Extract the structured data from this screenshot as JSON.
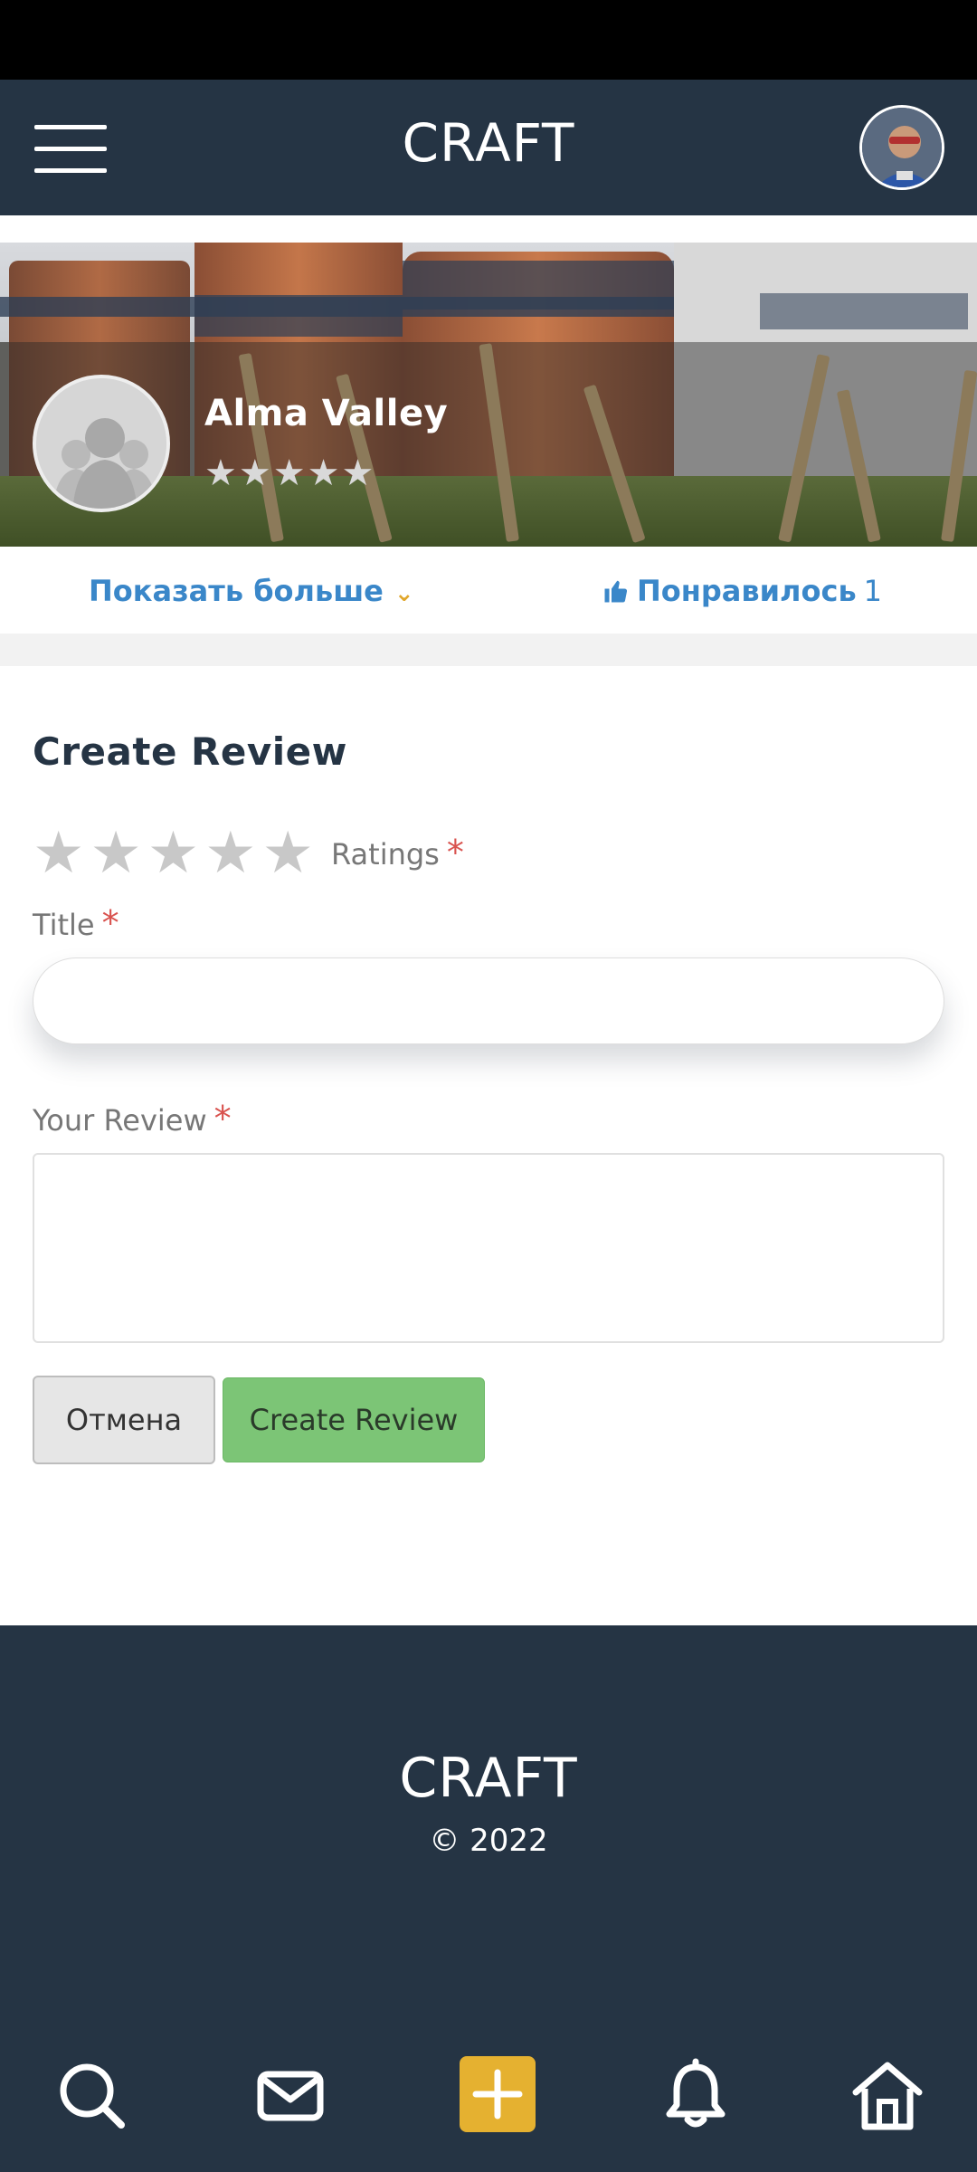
{
  "header": {
    "brand": "CRAFT",
    "menu_icon": "hamburger-menu-icon",
    "avatar_icon": "user-avatar"
  },
  "page": {
    "name": "Alma Valley",
    "rating_stars": "★★★★★",
    "avatar_icon": "group-placeholder-icon"
  },
  "actions": {
    "show_more_label": "Показать больше",
    "show_more_icon": "chevron-down-icon",
    "liked_label": "Понравилось",
    "liked_count": "1",
    "liked_icon": "thumbs-up-icon"
  },
  "form": {
    "heading": "Create Review",
    "ratings_label": "Ratings",
    "required_mark": "*",
    "title_label": "Title",
    "title_value": "",
    "review_label": "Your Review",
    "review_value": "",
    "cancel_label": "Отмена",
    "submit_label": "Create Review"
  },
  "footer": {
    "brand": "CRAFT",
    "copyright": "© 2022"
  },
  "bottom_nav": {
    "items": [
      "search-icon",
      "mail-icon",
      "plus-icon",
      "bell-icon",
      "home-icon"
    ]
  },
  "colors": {
    "navy": "#253444",
    "link_blue": "#3a87c9",
    "accent_yellow": "#e5b130",
    "submit_green": "#7cc576",
    "required_red": "#d9534f"
  }
}
